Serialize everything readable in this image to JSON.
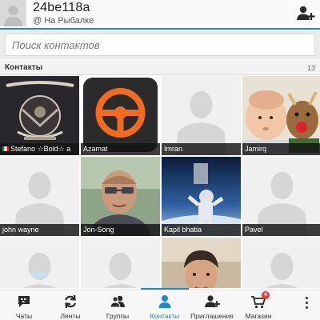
{
  "header": {
    "user_name": "24be118a",
    "status": "@ На Рыбалке",
    "add_contact_icon": "add-person-icon"
  },
  "search": {
    "placeholder": "Поиск контактов"
  },
  "section": {
    "title": "Контакты",
    "count": "13"
  },
  "contacts": [
    {
      "name": "Stefano ☆Bold☆ a",
      "picture": "ramones-shirt-photo",
      "flag": "italy"
    },
    {
      "name": "Azamat",
      "picture": "steering-wheel-icon"
    },
    {
      "name": "Imran",
      "picture": "default-avatar"
    },
    {
      "name": "Jamirq",
      "picture": "baby-with-toy-photo"
    },
    {
      "name": "john wayne",
      "picture": "default-avatar"
    },
    {
      "name": "Jon-Song",
      "picture": "man-with-glasses-photo"
    },
    {
      "name": "Kapil bhatia",
      "picture": "astronaut-photo"
    },
    {
      "name": "Pavel",
      "picture": "default-avatar"
    },
    {
      "name": "",
      "picture": "default-avatar"
    },
    {
      "name": "",
      "picture": "default-avatar"
    },
    {
      "name": "",
      "picture": "young-man-photo"
    },
    {
      "name": "",
      "picture": "default-avatar"
    }
  ],
  "tabs": [
    {
      "label": "Чаты",
      "icon": "bbm-chat-icon"
    },
    {
      "label": "Ленты",
      "icon": "refresh-icon"
    },
    {
      "label": "Группы",
      "icon": "groups-icon"
    },
    {
      "label": "Контакты",
      "icon": "contact-icon",
      "active": true
    },
    {
      "label": "Приглашения",
      "icon": "invite-icon"
    },
    {
      "label": "Магазин",
      "icon": "shop-cart-icon",
      "badge": "★"
    }
  ],
  "colors": {
    "accent": "#1a8dc9",
    "label_bg": "#141414",
    "badge": "#e53935"
  }
}
